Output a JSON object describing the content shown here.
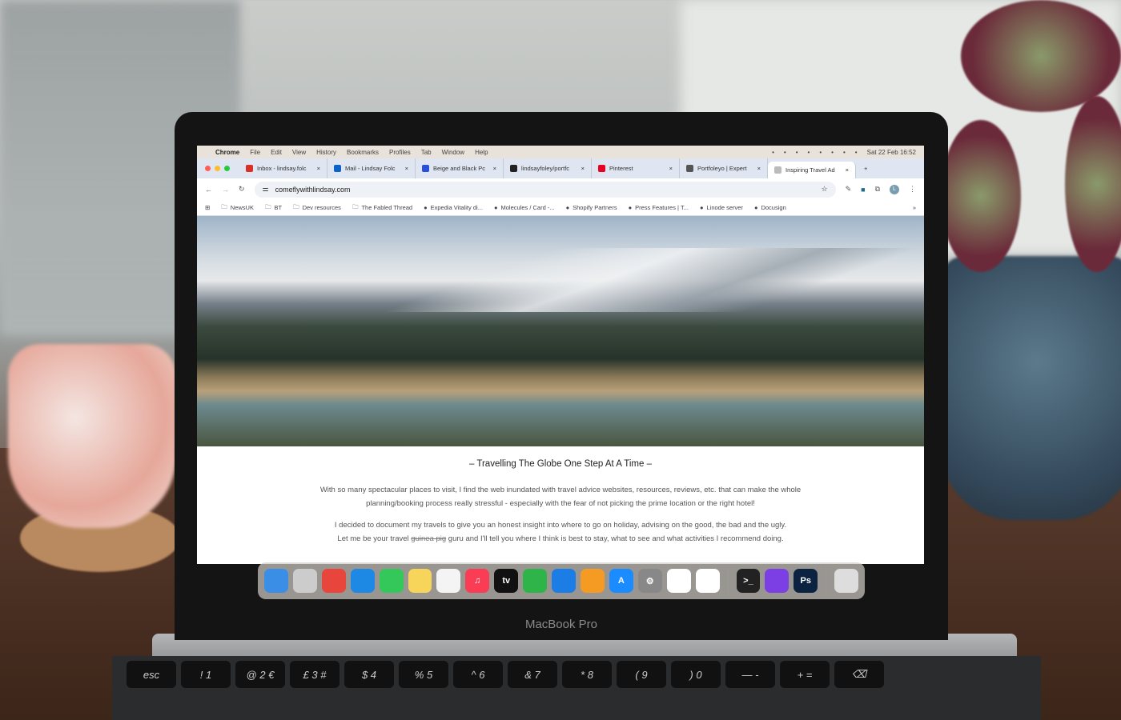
{
  "menubar": {
    "apple_icon": "apple-icon",
    "items": [
      "Chrome",
      "File",
      "Edit",
      "View",
      "History",
      "Bookmarks",
      "Profiles",
      "Tab",
      "Window",
      "Help"
    ],
    "status_icons": [
      "screen-sharing-icon",
      "bluetooth-icon",
      "display-icon",
      "battery-icon",
      "wifi-icon",
      "keyboard-icon",
      "search-icon",
      "control-center-icon"
    ],
    "datetime": "Sat 22 Feb 16:52"
  },
  "tabs": [
    {
      "title": "Inbox - lindsay.folc",
      "icon": "gmail-icon",
      "color": "#d93025"
    },
    {
      "title": "Mail - Lindsay Folc",
      "icon": "outlook-icon",
      "color": "#0a64c8"
    },
    {
      "title": "Beige and Black Pc",
      "icon": "canva-icon",
      "color": "#2b4fd8"
    },
    {
      "title": "lindsayfoley/portfc",
      "icon": "github-icon",
      "color": "#222222"
    },
    {
      "title": "Pinterest",
      "icon": "pinterest-icon",
      "color": "#e60023"
    },
    {
      "title": "Portfoleyo | Expert",
      "icon": "globe-icon",
      "color": "#555555"
    },
    {
      "title": "Inspiring Travel Ad",
      "icon": "site-icon",
      "color": "#bbbbbb",
      "active": true
    }
  ],
  "new_tab": "+",
  "address": {
    "url": "comeflywithlindsay.com"
  },
  "bookmarks": [
    {
      "label": "NewsUK",
      "icon": "folder-icon"
    },
    {
      "label": "BT",
      "icon": "folder-icon"
    },
    {
      "label": "Dev resources",
      "icon": "folder-icon"
    },
    {
      "label": "The Fabled Thread",
      "icon": "folder-icon"
    },
    {
      "label": "Expedia Vitality di...",
      "icon": "vitality-icon"
    },
    {
      "label": "Molecules / Card -...",
      "icon": "globe-icon"
    },
    {
      "label": "Shopify Partners",
      "icon": "shopify-icon"
    },
    {
      "label": "Press Features | T...",
      "icon": "sparkle-icon"
    },
    {
      "label": "Linode server",
      "icon": "linode-icon"
    },
    {
      "label": "Docusign",
      "icon": "docusign-icon"
    }
  ],
  "bookmarks_more": "»",
  "page": {
    "heading": "– Travelling The Globe One Step At A Time –",
    "p1": "With so many spectacular places to visit, I find the web inundated with travel advice websites, resources, reviews, etc. that can make the whole planning/booking process really stressful - especially with the fear of not picking the prime location or the right hotel!",
    "p2": "I decided to document my travels to give you an honest insight into where to go on holiday, advising on the good, the bad and the ugly.",
    "p3_before": "Let me be your travel ",
    "p3_struck": "guinea pig",
    "p3_after": " guru and I'll tell you where I think is best to stay, what to see and what activities I recommend doing."
  },
  "dock": [
    {
      "name": "finder",
      "color": "#3a8ee6",
      "label": ""
    },
    {
      "name": "launchpad",
      "color": "#ccc",
      "label": ""
    },
    {
      "name": "chrome",
      "color": "#e8453c",
      "label": ""
    },
    {
      "name": "safari",
      "color": "#1e88e5",
      "label": ""
    },
    {
      "name": "messages",
      "color": "#34c759",
      "label": ""
    },
    {
      "name": "notes",
      "color": "#f7d55a",
      "label": ""
    },
    {
      "name": "freeform",
      "color": "#f4f4f4",
      "label": ""
    },
    {
      "name": "music",
      "color": "#fa3c55",
      "label": "♫"
    },
    {
      "name": "tv",
      "color": "#111",
      "label": "tv"
    },
    {
      "name": "numbers",
      "color": "#2fb44a",
      "label": ""
    },
    {
      "name": "keynote",
      "color": "#1d7de6",
      "label": ""
    },
    {
      "name": "pages",
      "color": "#f59a23",
      "label": ""
    },
    {
      "name": "app-store",
      "color": "#1a8cff",
      "label": "A"
    },
    {
      "name": "system-settings",
      "color": "#888",
      "label": "⚙"
    },
    {
      "name": "slack",
      "color": "#fff",
      "label": ""
    },
    {
      "name": "vscode",
      "color": "#fff",
      "label": ""
    },
    {
      "name": "terminal",
      "color": "#222",
      "label": ">_"
    },
    {
      "name": "github-desktop",
      "color": "#7b3fe4",
      "label": ""
    },
    {
      "name": "photoshop",
      "color": "#0b2240",
      "label": "Ps"
    },
    {
      "name": "trash",
      "color": "#ddd",
      "label": ""
    }
  ],
  "laptop": {
    "model": "MacBook Pro",
    "keys": [
      "esc",
      "! 1",
      "@ 2 €",
      "£ 3 #",
      "$ 4",
      "% 5",
      "^ 6",
      "& 7",
      "* 8",
      "( 9",
      ") 0",
      "— -",
      "+ =",
      "⌫"
    ]
  }
}
